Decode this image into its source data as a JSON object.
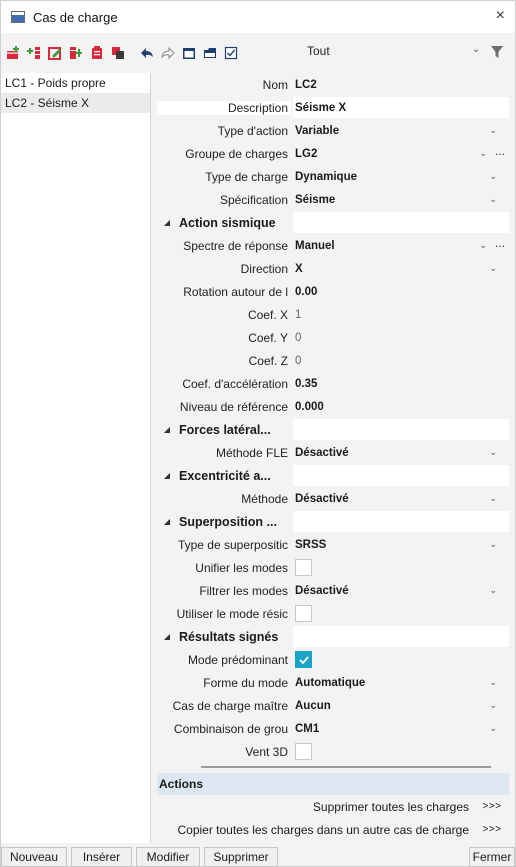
{
  "window": {
    "title": "Cas de charge",
    "close_glyph": "×"
  },
  "toolbar": {
    "icons": [
      "new-icon",
      "insert-icon",
      "edit-icon",
      "copy-icon",
      "delete-icon",
      "delete-all-icon",
      "undo-icon",
      "redo-icon",
      "table-icon",
      "save-icon",
      "checklist-icon"
    ],
    "filter_label": "Tout",
    "filter_chevron": "⌄"
  },
  "list": {
    "items": [
      {
        "label": "LC1 - Poids propre",
        "selected": false
      },
      {
        "label": "LC2 - Séisme X",
        "selected": true
      }
    ]
  },
  "properties": {
    "nom": {
      "label": "Nom",
      "value": "LC2"
    },
    "description": {
      "label": "Description",
      "value": "Séisme X"
    },
    "type_action": {
      "label": "Type d'action",
      "value": "Variable"
    },
    "groupe_charges": {
      "label": "Groupe de charges",
      "value": "LG2"
    },
    "type_charge": {
      "label": "Type de charge",
      "value": "Dynamique"
    },
    "specification": {
      "label": "Spécification",
      "value": "Séisme"
    },
    "section_action_sismique": "Action sismique",
    "spectre": {
      "label": "Spectre de réponse",
      "value": "Manuel"
    },
    "direction": {
      "label": "Direction",
      "value": "X"
    },
    "rotation": {
      "label": "Rotation autour de l",
      "value": "0.00"
    },
    "coef_x": {
      "label": "Coef. X",
      "value": "1"
    },
    "coef_y": {
      "label": "Coef. Y",
      "value": "0"
    },
    "coef_z": {
      "label": "Coef. Z",
      "value": "0"
    },
    "coef_acc": {
      "label": "Coef. d'accélération",
      "value": "0.35"
    },
    "niveau_ref": {
      "label": "Niveau de référence",
      "value": "0.000"
    },
    "section_forces": "Forces latéral...",
    "methode_fle": {
      "label": "Méthode FLE",
      "value": "Désactivé"
    },
    "section_excentricite": "Excentricité a...",
    "methode": {
      "label": "Méthode",
      "value": "Désactivé"
    },
    "section_superposition": "Superposition ...",
    "type_superposition": {
      "label": "Type de superpositic",
      "value": "SRSS"
    },
    "unifier_modes": {
      "label": "Unifier les modes",
      "checked": false
    },
    "filtrer_modes": {
      "label": "Filtrer les modes",
      "value": "Désactivé"
    },
    "utiliser_mode": {
      "label": "Utiliser le mode résic",
      "checked": false
    },
    "section_resultats": "Résultats signés",
    "mode_predominant": {
      "label": "Mode prédominant",
      "checked": true
    },
    "forme_mode": {
      "label": "Forme du mode",
      "value": "Automatique"
    },
    "cas_maitre": {
      "label": "Cas de charge maître",
      "value": "Aucun"
    },
    "combinaison": {
      "label": "Combinaison de grou",
      "value": "CM1"
    },
    "vent_3d": {
      "label": "Vent 3D",
      "checked": false
    }
  },
  "actions": {
    "title": "Actions",
    "items": [
      {
        "label": "Supprimer toutes les charges",
        "go": ">>>"
      },
      {
        "label": "Copier toutes les charges dans un autre cas de charge",
        "go": ">>>"
      }
    ]
  },
  "buttons": {
    "nouveau": "Nouveau",
    "inserer": "Insérer",
    "modifier": "Modifier",
    "supprimer": "Supprimer",
    "fermer": "Fermer"
  },
  "glyphs": {
    "dropdown": "⌄",
    "more": "...",
    "caret": "◢"
  },
  "colors": {
    "accent": "#1aa3c9",
    "actions_header": "#dce7f3",
    "delete_red": "#d8283a",
    "add_green": "#3d9a3d"
  }
}
